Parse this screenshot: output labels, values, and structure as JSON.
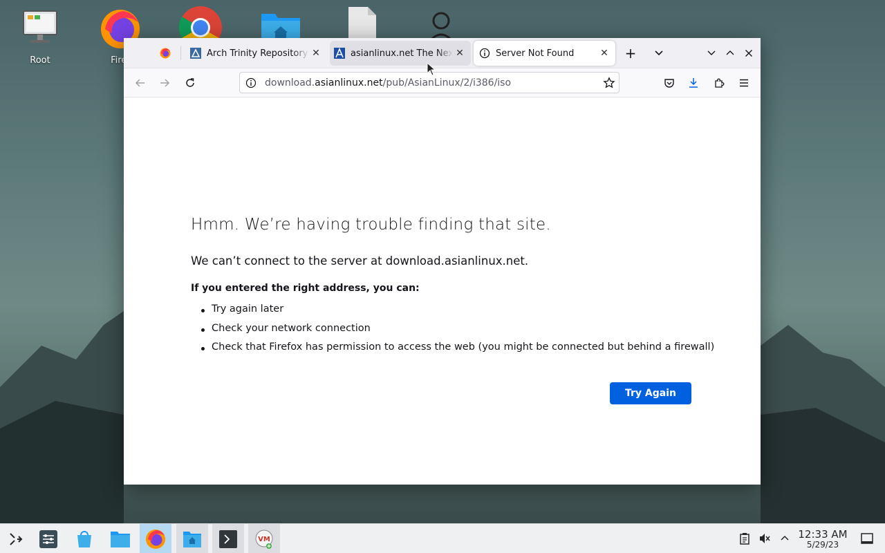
{
  "desktop": {
    "icons": [
      {
        "label": "Root",
        "icon": "computer-icon"
      },
      {
        "label": "Firef",
        "icon": "firefox-icon"
      },
      {
        "label": "",
        "icon": "chrome-icon"
      },
      {
        "label": "",
        "icon": "home-folder-icon"
      },
      {
        "label": "",
        "icon": "file-icon"
      },
      {
        "label": "",
        "icon": "user-icon"
      }
    ]
  },
  "browser": {
    "tabs": [
      {
        "title": "",
        "icon": "firefox-icon",
        "state": "pinned"
      },
      {
        "title": "Arch Trinity Repository I",
        "icon": "arch-trinity-icon",
        "state": "normal"
      },
      {
        "title": "asianlinux.net The Next",
        "icon": "asianlinux-icon",
        "state": "hover"
      },
      {
        "title": "Server Not Found",
        "icon": "info-icon",
        "state": "active"
      }
    ],
    "url": {
      "prefix": "download.",
      "host": "asianlinux.net",
      "path": "/pub/AsianLinux/2/i386/iso"
    },
    "error": {
      "title": "Hmm. We’re having trouble finding that site.",
      "subtitle": "We can’t connect to the server at download.asianlinux.net.",
      "bold": "If you entered the right address, you can:",
      "items": [
        "Try again later",
        "Check your network connection",
        "Check that Firefox has permission to access the web (you might be connected but behind a firewall)"
      ],
      "button": "Try Again"
    },
    "colors": {
      "accent": "#0061e0",
      "download_icon": "#0061e0"
    }
  },
  "taskbar": {
    "items": [
      "app-launcher-icon",
      "settings-icon",
      "discover-icon",
      "folder-icon",
      "firefox-icon",
      "home-folder-icon",
      "terminal-icon",
      "vm-icon"
    ],
    "clock": {
      "time": "12:33 AM",
      "date": "5/29/23"
    },
    "tray": [
      "clipboard-icon",
      "volume-muted-icon",
      "chevron-up-icon",
      "show-desktop-icon"
    ]
  }
}
